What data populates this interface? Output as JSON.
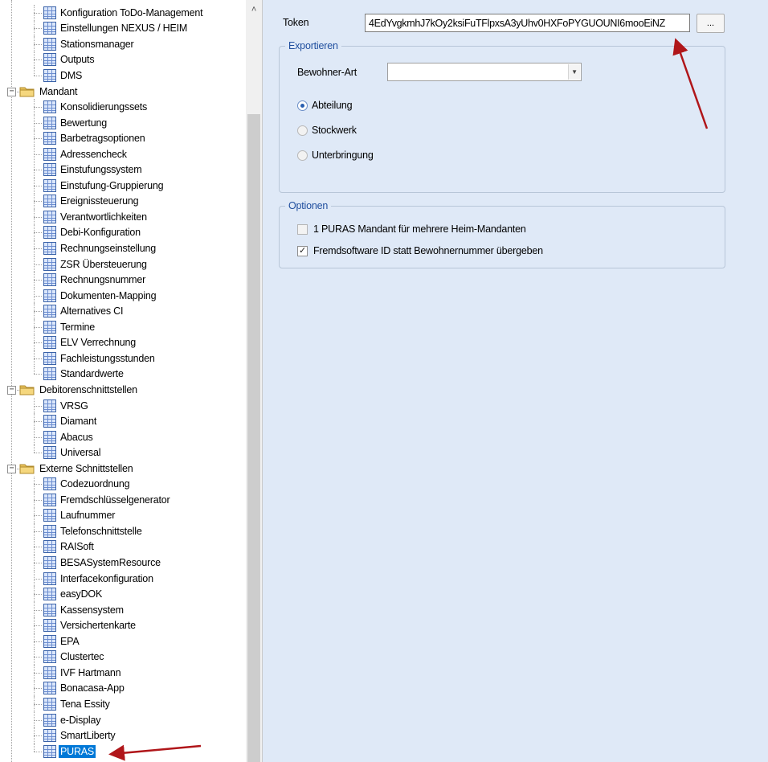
{
  "tree": {
    "rows": [
      {
        "label": "Konfiguration ToDo-Management",
        "type": "leaf",
        "depth": 2
      },
      {
        "label": "Einstellungen NEXUS / HEIM",
        "type": "leaf",
        "depth": 2
      },
      {
        "label": "Stationsmanager",
        "type": "leaf",
        "depth": 2
      },
      {
        "label": "Outputs",
        "type": "leaf",
        "depth": 2
      },
      {
        "label": "DMS",
        "type": "leaf",
        "depth": 2
      },
      {
        "label": "Mandant",
        "type": "folder",
        "depth": 1,
        "expanded": true
      },
      {
        "label": "Konsolidierungssets",
        "type": "leaf",
        "depth": 2
      },
      {
        "label": "Bewertung",
        "type": "leaf",
        "depth": 2
      },
      {
        "label": "Barbetragsoptionen",
        "type": "leaf",
        "depth": 2
      },
      {
        "label": "Adressencheck",
        "type": "leaf",
        "depth": 2
      },
      {
        "label": "Einstufungssystem",
        "type": "leaf",
        "depth": 2
      },
      {
        "label": "Einstufung-Gruppierung",
        "type": "leaf",
        "depth": 2
      },
      {
        "label": "Ereignissteuerung",
        "type": "leaf",
        "depth": 2
      },
      {
        "label": "Verantwortlichkeiten",
        "type": "leaf",
        "depth": 2
      },
      {
        "label": "Debi-Konfiguration",
        "type": "leaf",
        "depth": 2
      },
      {
        "label": "Rechnungseinstellung",
        "type": "leaf",
        "depth": 2
      },
      {
        "label": "ZSR Übersteuerung",
        "type": "leaf",
        "depth": 2
      },
      {
        "label": "Rechnungsnummer",
        "type": "leaf",
        "depth": 2
      },
      {
        "label": "Dokumenten-Mapping",
        "type": "leaf",
        "depth": 2
      },
      {
        "label": "Alternatives CI",
        "type": "leaf",
        "depth": 2
      },
      {
        "label": "Termine",
        "type": "leaf",
        "depth": 2
      },
      {
        "label": "ELV Verrechnung",
        "type": "leaf",
        "depth": 2
      },
      {
        "label": "Fachleistungsstunden",
        "type": "leaf",
        "depth": 2
      },
      {
        "label": "Standardwerte",
        "type": "leaf",
        "depth": 2
      },
      {
        "label": "Debitorenschnittstellen",
        "type": "folder",
        "depth": 1,
        "expanded": true
      },
      {
        "label": "VRSG",
        "type": "leaf",
        "depth": 2
      },
      {
        "label": "Diamant",
        "type": "leaf",
        "depth": 2
      },
      {
        "label": "Abacus",
        "type": "leaf",
        "depth": 2
      },
      {
        "label": "Universal",
        "type": "leaf",
        "depth": 2
      },
      {
        "label": "Externe Schnittstellen",
        "type": "folder",
        "depth": 1,
        "expanded": true
      },
      {
        "label": "Codezuordnung",
        "type": "leaf",
        "depth": 2
      },
      {
        "label": "Fremdschlüsselgenerator",
        "type": "leaf",
        "depth": 2
      },
      {
        "label": "Laufnummer",
        "type": "leaf",
        "depth": 2
      },
      {
        "label": "Telefonschnittstelle",
        "type": "leaf",
        "depth": 2
      },
      {
        "label": "RAISoft",
        "type": "leaf",
        "depth": 2
      },
      {
        "label": "BESASystemResource",
        "type": "leaf",
        "depth": 2
      },
      {
        "label": "Interfacekonfiguration",
        "type": "leaf",
        "depth": 2
      },
      {
        "label": "easyDOK",
        "type": "leaf",
        "depth": 2
      },
      {
        "label": "Kassensystem",
        "type": "leaf",
        "depth": 2
      },
      {
        "label": "Versichertenkarte",
        "type": "leaf",
        "depth": 2
      },
      {
        "label": "EPA",
        "type": "leaf",
        "depth": 2
      },
      {
        "label": "Clustertec",
        "type": "leaf",
        "depth": 2
      },
      {
        "label": "IVF Hartmann",
        "type": "leaf",
        "depth": 2
      },
      {
        "label": "Bonacasa-App",
        "type": "leaf",
        "depth": 2
      },
      {
        "label": "Tena Essity",
        "type": "leaf",
        "depth": 2
      },
      {
        "label": "e-Display",
        "type": "leaf",
        "depth": 2
      },
      {
        "label": "SmartLiberty",
        "type": "leaf",
        "depth": 2
      },
      {
        "label": "PURAS",
        "type": "leaf",
        "depth": 2,
        "selected": true
      }
    ]
  },
  "token": {
    "label": "Token",
    "value": "4EdYvgkmhJ7kOy2ksiFuTFlpxsA3yUhv0HXFoPYGUOUNI6mooEiNZ",
    "browse_label": "..."
  },
  "export": {
    "title": "Exportieren",
    "bewohner_label": "Bewohner-Art",
    "bewohner_value": "",
    "radios": [
      {
        "label": "Abteilung",
        "checked": true
      },
      {
        "label": "Stockwerk",
        "checked": false
      },
      {
        "label": "Unterbringung",
        "checked": false
      }
    ]
  },
  "options": {
    "title": "Optionen",
    "checkboxes": [
      {
        "label": "1 PURAS Mandant für mehrere Heim-Mandanten",
        "checked": false
      },
      {
        "label": "Fremdsoftware ID statt Bewohnernummer übergeben",
        "checked": true
      }
    ]
  },
  "colors": {
    "panel_bg": "#dfe9f7",
    "selection": "#0078d7",
    "annotation_arrow": "#b0161a"
  }
}
